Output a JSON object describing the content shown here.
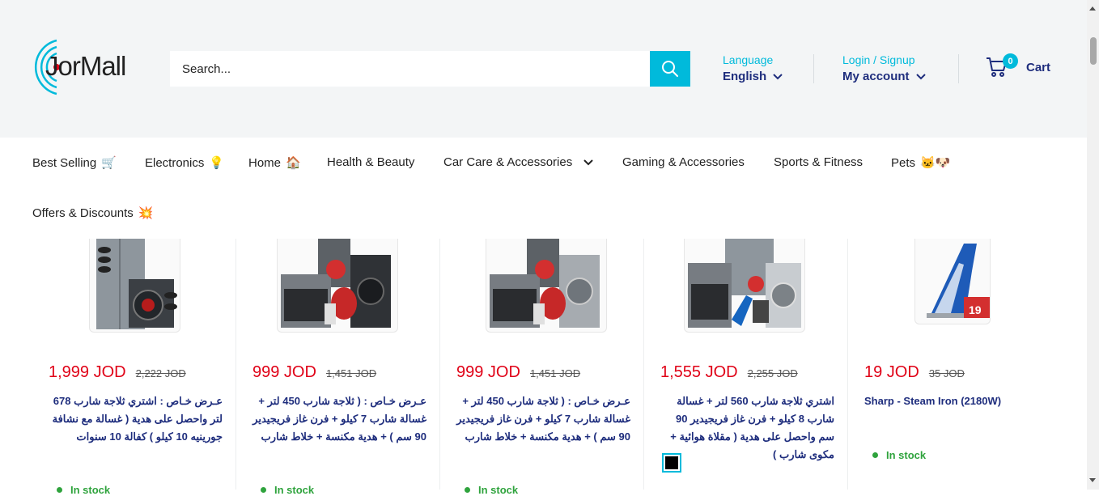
{
  "brand": {
    "name": "JorMall",
    "accent": "#00badb",
    "navy": "#1e2d7d",
    "sale_red": "#e00016",
    "stock_green": "#2fa33d"
  },
  "search": {
    "placeholder": "Search..."
  },
  "language": {
    "label": "Language",
    "value": "English"
  },
  "account": {
    "label": "Login / Signup",
    "value": "My account"
  },
  "cart": {
    "count": "0",
    "label": "Cart"
  },
  "nav": {
    "items": [
      {
        "label": "Best Selling",
        "icon": "🛒"
      },
      {
        "label": "Electronics",
        "icon": "💡"
      },
      {
        "label": "Home",
        "icon": "🏠"
      },
      {
        "label": "Health & Beauty",
        "icon": ""
      },
      {
        "label": "Car Care & Accessories",
        "icon": "chevron-down-icon"
      },
      {
        "label": "Gaming & Accessories",
        "icon": ""
      },
      {
        "label": "Sports & Fitness",
        "icon": ""
      },
      {
        "label": "Pets",
        "icon": "🐱🐶"
      },
      {
        "label": "Offers & Discounts",
        "icon": "💥"
      }
    ]
  },
  "products": [
    {
      "price": "1,999 JOD",
      "old_price": "2,222 JOD",
      "title": "عـرض خـاص : اشتري ثلاجة شارب 678 لتر واحصل على هدية ( غسالة مع نشافة جورينيه 10 كيلو ) كفالة 10 سنوات",
      "stock": "In stock"
    },
    {
      "price": "999 JOD",
      "old_price": "1,451 JOD",
      "title": "عـرض خـاص : ( ثلاجة شارب 450 لتر + غسالة شارب 7 كيلو + فرن غاز فريجيدير 90 سم ) + هدية مكنسة + خلاط شارب",
      "stock": "In stock"
    },
    {
      "price": "999 JOD",
      "old_price": "1,451 JOD",
      "title": "عـرض خـاص : ( ثلاجة شارب 450 لتر + غسالة شارب 7 كيلو + فرن غاز فريجيدير 90 سم ) + هدية مكنسة + خلاط شارب",
      "stock": "In stock"
    },
    {
      "price": "1,555 JOD",
      "old_price": "2,255 JOD",
      "title": "اشتري ثلاجة شارب 560 لتر + غسالة شارب 8 كيلو + فرن غاز فريجيدير 90 سم واحصل على هدية ( مقلاة هوائية + مكوى شارب )",
      "stock": ""
    },
    {
      "price": "19 JOD",
      "old_price": "35 JOD",
      "title": "Sharp - Steam Iron (2180W)",
      "stock": "In stock"
    }
  ]
}
